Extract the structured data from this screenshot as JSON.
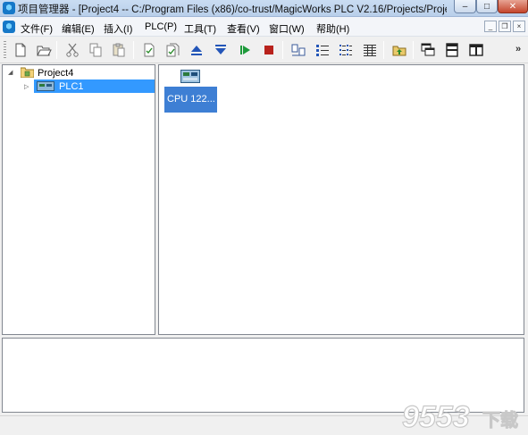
{
  "window": {
    "title": "项目管理器 - [Project4 -- C:/Program Files (x86)/co-trust/MagicWorks PLC V2.16/Projects/Proje...",
    "icon": "app-logo-icon",
    "controls": {
      "minimize": "–",
      "maximize": "□",
      "close": "✕"
    }
  },
  "menubar": {
    "items": [
      {
        "label": "文件(F)"
      },
      {
        "label": "编辑(E)"
      },
      {
        "label": "插入(I)"
      },
      {
        "label": "PLC(P)"
      },
      {
        "label": "工具(T)"
      },
      {
        "label": "查看(V)"
      },
      {
        "label": "窗口(W)"
      },
      {
        "label": "帮助(H)"
      }
    ],
    "mdi_controls": {
      "minimize": "_",
      "restore": "❐",
      "close": "×"
    }
  },
  "toolbar": {
    "buttons": [
      {
        "icon": "new-file-icon"
      },
      {
        "icon": "open-folder-icon"
      },
      {
        "icon": "cut-icon"
      },
      {
        "icon": "copy-icon"
      },
      {
        "icon": "paste-icon"
      },
      {
        "icon": "compile-icon"
      },
      {
        "icon": "compile-all-icon"
      },
      {
        "icon": "upload-icon"
      },
      {
        "icon": "download-icon"
      },
      {
        "icon": "run-icon"
      },
      {
        "icon": "stop-icon"
      },
      {
        "icon": "network-scan-icon"
      },
      {
        "icon": "list-view-icon"
      },
      {
        "icon": "detail-view-icon"
      },
      {
        "icon": "grid-view-icon"
      },
      {
        "icon": "folder-up-icon"
      },
      {
        "icon": "windows-cascade-icon"
      },
      {
        "icon": "split-horizontal-icon"
      },
      {
        "icon": "split-vertical-icon"
      }
    ],
    "overflow": "»"
  },
  "tree": {
    "root": {
      "label": "Project4",
      "expanded": true
    },
    "children": [
      {
        "label": "PLC1",
        "selected": true
      }
    ]
  },
  "devices": [
    {
      "label": "CPU 122...",
      "selected": true
    }
  ],
  "watermark": {
    "text": "9553",
    "suffix": "下载"
  },
  "colors": {
    "selection": "#3399ff",
    "device_card": "#3e7fd4",
    "titlebar": "#c2d7f0"
  }
}
